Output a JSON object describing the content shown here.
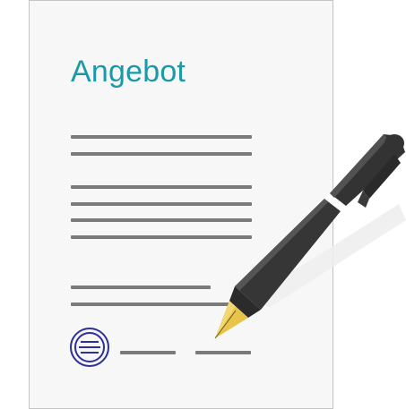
{
  "document": {
    "title": "Angebot"
  },
  "colors": {
    "title": "#1a9aa8",
    "paper": "#f7f7f7",
    "paper_border": "#c4c4c4",
    "text_lines": "#7a7a7a",
    "stamp": "#2d2f9a",
    "pen_body": "#333333",
    "pen_tip": "#e8c44a"
  },
  "icons": {
    "stamp": "round-seal-icon",
    "pen": "fountain-pen-icon"
  }
}
